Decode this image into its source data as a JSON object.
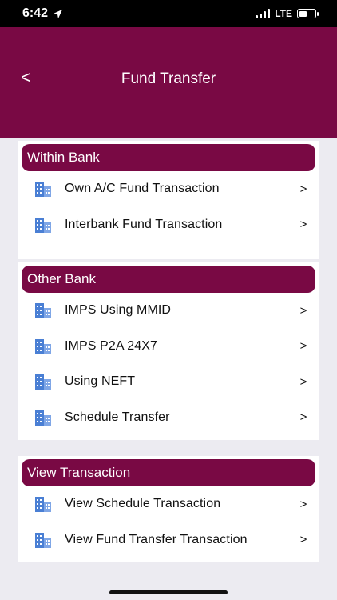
{
  "status": {
    "time": "6:42",
    "network": "LTE",
    "battery_level": 0.5
  },
  "header": {
    "back_label": "<",
    "title": "Fund Transfer"
  },
  "colors": {
    "brand": "#790944",
    "icon": "#4a7fd4",
    "background": "#ecebf1"
  },
  "sections": [
    {
      "title": "Within Bank",
      "items": [
        {
          "label": "Own A/C Fund Transaction",
          "icon": "building-icon"
        },
        {
          "label": "Interbank Fund Transaction",
          "icon": "building-icon"
        }
      ]
    },
    {
      "title": "Other Bank",
      "items": [
        {
          "label": "IMPS Using MMID",
          "icon": "building-icon"
        },
        {
          "label": "IMPS P2A 24X7",
          "icon": "building-icon"
        },
        {
          "label": "Using NEFT",
          "icon": "building-icon"
        },
        {
          "label": "Schedule Transfer",
          "icon": "building-icon"
        }
      ]
    },
    {
      "title": "View Transaction",
      "items": [
        {
          "label": "View Schedule Transaction",
          "icon": "building-icon"
        },
        {
          "label": "View Fund Transfer Transaction",
          "icon": "building-icon"
        }
      ]
    }
  ]
}
